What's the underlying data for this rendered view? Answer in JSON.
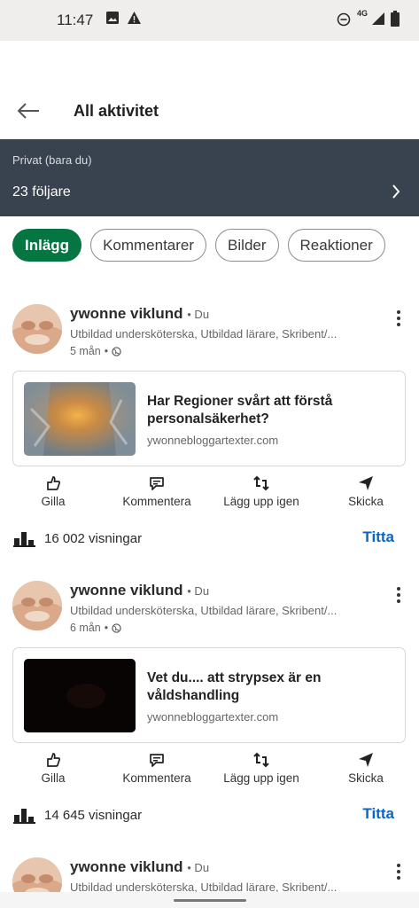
{
  "status_bar": {
    "time": "11:47",
    "network": "4G",
    "icons": [
      "image-icon",
      "warning-icon",
      "do-not-disturb-icon",
      "signal-icon",
      "battery-icon"
    ]
  },
  "header": {
    "title": "All aktivitet",
    "back_icon": "arrow-left-icon"
  },
  "banner": {
    "privacy": "Privat (bara du)",
    "followers": "23 följare"
  },
  "filters": [
    {
      "label": "Inlägg",
      "active": true
    },
    {
      "label": "Kommentarer",
      "active": false
    },
    {
      "label": "Bilder",
      "active": false
    },
    {
      "label": "Reaktioner",
      "active": false
    }
  ],
  "actions": {
    "like": "Gilla",
    "comment": "Kommentera",
    "repost": "Lägg upp igen",
    "send": "Skicka"
  },
  "posts": [
    {
      "author": "ywonne viklund",
      "degree": "• Du",
      "headline": "Utbildad undersköterska, Utbildad lärare, Skribent/...",
      "age": "5 mån",
      "link_title": "Har Regioner svårt att förstå personalsäkerhet?",
      "link_domain": "ywonnebloggartexter.com",
      "views": "16 002 visningar",
      "view_action": "Titta"
    },
    {
      "author": "ywonne viklund",
      "degree": "• Du",
      "headline": "Utbildad undersköterska, Utbildad lärare, Skribent/...",
      "age": "6 mån",
      "link_title": "Vet du.... att strypsex är en våldshandling",
      "link_domain": "ywonnebloggartexter.com",
      "views": "14 645 visningar",
      "view_action": "Titta"
    },
    {
      "author": "ywonne viklund",
      "degree": "• Du",
      "headline": "Utbildad undersköterska, Utbildad lärare, Skribent/..."
    }
  ],
  "colors": {
    "accent_green": "#057642",
    "link_blue": "#0a66c2",
    "banner_bg": "#38434f"
  }
}
